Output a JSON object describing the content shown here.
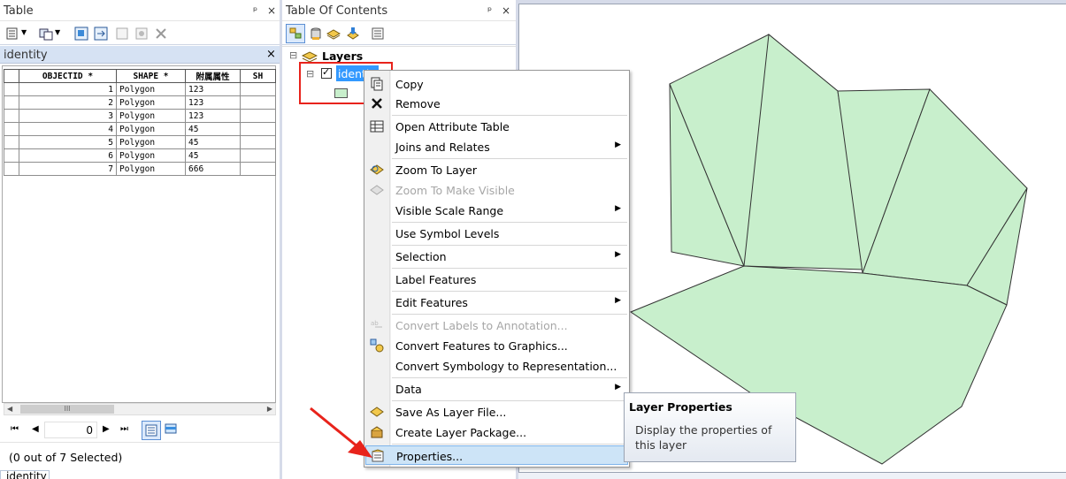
{
  "table_panel": {
    "title": "Table",
    "pin": "ᵖ",
    "close": "×",
    "tab_title": "identity",
    "columns": [
      "OBJECTID *",
      "SHAPE *",
      "附属属性",
      "SH"
    ],
    "rows": [
      {
        "id": "1",
        "shape": "Polygon",
        "attr": "123"
      },
      {
        "id": "2",
        "shape": "Polygon",
        "attr": "123"
      },
      {
        "id": "3",
        "shape": "Polygon",
        "attr": "123"
      },
      {
        "id": "4",
        "shape": "Polygon",
        "attr": "45"
      },
      {
        "id": "5",
        "shape": "Polygon",
        "attr": "45"
      },
      {
        "id": "6",
        "shape": "Polygon",
        "attr": "45"
      },
      {
        "id": "7",
        "shape": "Polygon",
        "attr": "666"
      }
    ],
    "scroll_thumb": "III",
    "record_index": "0",
    "selection_status": "(0 out of 7 Selected)",
    "bottom_tab": "identity"
  },
  "toc": {
    "title": "Table Of Contents",
    "root_label": "Layers",
    "layer_name": "identity",
    "expander": "⊟"
  },
  "context_menu": {
    "items": [
      {
        "label": "Copy"
      },
      {
        "label": "Remove"
      },
      {
        "label": "Open Attribute Table"
      },
      {
        "label": "Joins and Relates"
      },
      {
        "label": "Zoom To Layer"
      },
      {
        "label": "Zoom To Make Visible"
      },
      {
        "label": "Visible Scale Range"
      },
      {
        "label": "Use Symbol Levels"
      },
      {
        "label": "Selection"
      },
      {
        "label": "Label Features"
      },
      {
        "label": "Edit Features"
      },
      {
        "label": "Convert Labels to Annotation..."
      },
      {
        "label": "Convert Features to Graphics..."
      },
      {
        "label": "Convert Symbology to Representation..."
      },
      {
        "label": "Data"
      },
      {
        "label": "Save As Layer File..."
      },
      {
        "label": "Create Layer Package..."
      },
      {
        "label": "Properties..."
      }
    ],
    "submenu_arrow": "▶"
  },
  "tooltip": {
    "title": "Layer Properties",
    "body": "Display the properties of this layer"
  },
  "colors": {
    "polygon_fill": "#c8efcc",
    "highlight_box": "#e8231b",
    "selection_blue": "#3399ff"
  }
}
